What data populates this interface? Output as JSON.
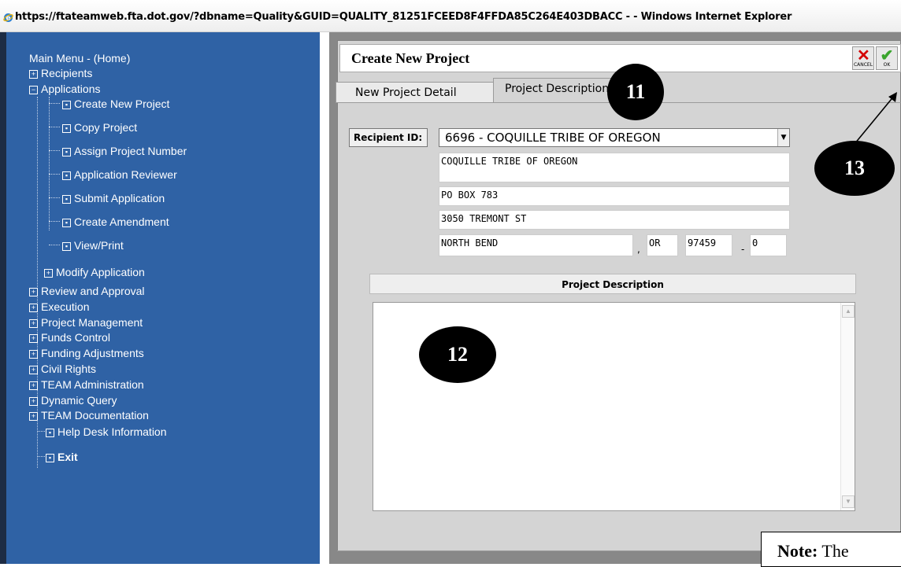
{
  "window": {
    "title": "https://ftateamweb.fta.dot.gov/?dbname=Quality&GUID=QUALITY_81251FCEED8F4FFDA85C264E403DBACC -  - Windows Internet Explorer"
  },
  "sidebar": {
    "items": [
      {
        "label": "Main Menu - (Home)",
        "icon": "none"
      },
      {
        "label": "Recipients",
        "icon": "plus"
      },
      {
        "label": "Applications",
        "icon": "minus"
      },
      {
        "label": "Create New Project",
        "icon": "bullet"
      },
      {
        "label": "Copy Project",
        "icon": "bullet"
      },
      {
        "label": "Assign Project Number",
        "icon": "bullet"
      },
      {
        "label": "Application Reviewer",
        "icon": "bullet"
      },
      {
        "label": "Submit Application",
        "icon": "bullet"
      },
      {
        "label": "Create Amendment",
        "icon": "bullet"
      },
      {
        "label": "View/Print",
        "icon": "bullet"
      },
      {
        "label": "Modify Application",
        "icon": "plus"
      },
      {
        "label": "Review and Approval",
        "icon": "plus"
      },
      {
        "label": "Execution",
        "icon": "plus"
      },
      {
        "label": "Project Management",
        "icon": "plus"
      },
      {
        "label": "Funds Control",
        "icon": "plus"
      },
      {
        "label": "Funding Adjustments",
        "icon": "plus"
      },
      {
        "label": "Civil Rights",
        "icon": "plus"
      },
      {
        "label": "TEAM Administration",
        "icon": "plus"
      },
      {
        "label": "Dynamic Query",
        "icon": "plus"
      },
      {
        "label": "TEAM Documentation",
        "icon": "plus"
      },
      {
        "label": "Help Desk Information",
        "icon": "bullet"
      },
      {
        "label": "Exit",
        "icon": "bullet"
      }
    ]
  },
  "header": {
    "title": "Create New Project",
    "cancel_label": "CANCEL",
    "ok_label": "OK"
  },
  "tabs": [
    {
      "label": "New Project Detail",
      "active": false
    },
    {
      "label": "Project Description",
      "active": true
    }
  ],
  "form": {
    "recipient_label": "Recipient ID:",
    "recipient_selected": "6696 - COQUILLE TRIBE OF OREGON",
    "name": "COQUILLE TRIBE OF OREGON",
    "address1": "PO BOX 783",
    "address2": "3050 TREMONT ST",
    "city": "NORTH BEND",
    "state": "OR",
    "zip": "97459",
    "zip_ext": "0",
    "comma": ",",
    "dash": "-"
  },
  "description": {
    "header": "Project Description",
    "value": ""
  },
  "callouts": {
    "c11": "11",
    "c12": "12",
    "c13": "13"
  },
  "note": {
    "label": "Note:",
    "text": "The"
  },
  "colors": {
    "sidebar_bg": "#2f62a5",
    "panel_bg": "#d4d4d4",
    "cancel_red": "#d40000",
    "ok_green": "#3aa52d"
  }
}
